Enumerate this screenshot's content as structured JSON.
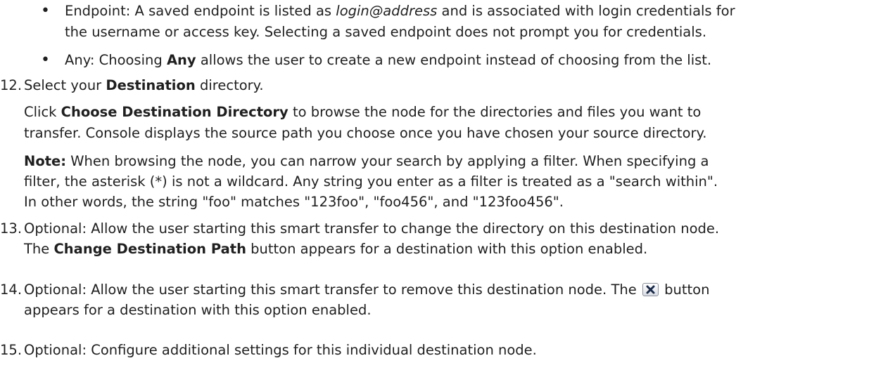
{
  "bullets": [
    {
      "line1": {
        "label": "Endpoint: A saved endpoint is listed as ",
        "em": "login@address",
        "rest": " and is associated with login credentials for"
      },
      "line2": "the username or access key. Selecting a saved endpoint does not prompt you for credentials."
    },
    {
      "pre": "Any: Choosing ",
      "bold": "Any",
      "post": " allows the user to create a new endpoint instead of choosing from the list."
    }
  ],
  "step12": {
    "number": "12.",
    "pre": "Select your ",
    "bold": "Destination",
    "post": " directory.",
    "click_pre": "Click ",
    "click_bold": "Choose Destination Directory",
    "click_post": " to browse the node for the directories and files you want to",
    "click_line2": "transfer. Console displays the source path you choose once you have chosen your source directory.",
    "note_label": "Note:",
    "note_line1": " When browsing the node, you can narrow your search by applying a filter. When specifying a",
    "note_line2": "filter, the asterisk (*) is not a wildcard. Any string you enter as a filter is treated as a \"search within\".",
    "note_line3": "In other words, the string \"foo\" matches \"123foo\", \"foo456\", and \"123foo456\"."
  },
  "step13": {
    "number": "13.",
    "line1": "Optional: Allow the user starting this smart transfer to change the directory on this destination node.",
    "line2_pre": "The ",
    "line2_bold": "Change Destination Path",
    "line2_post": " button appears for a destination with this option enabled."
  },
  "step14": {
    "number": "14.",
    "line1_pre": "Optional: Allow the user starting this smart transfer to remove this destination node. The ",
    "line1_post": " button",
    "line2": "appears for a destination with this option enabled."
  },
  "step15": {
    "number": "15.",
    "line1": "Optional: Configure additional settings for this individual destination node."
  }
}
